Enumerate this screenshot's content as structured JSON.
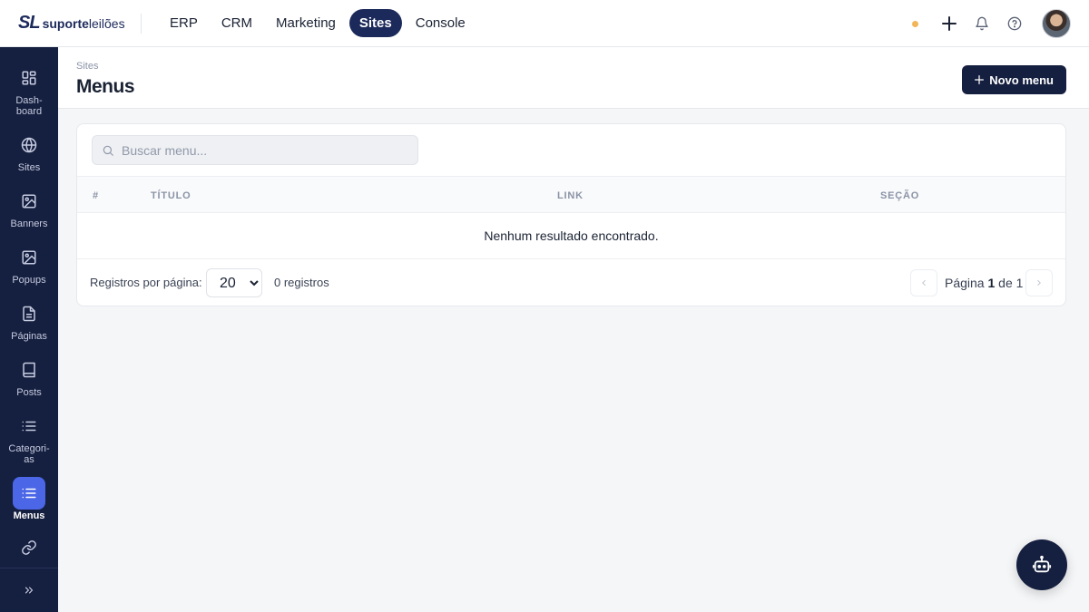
{
  "brand": {
    "mark": "SL",
    "name_bold": "suporte",
    "name_light": "leilões"
  },
  "topnav": [
    {
      "label": "ERP",
      "active": false
    },
    {
      "label": "CRM",
      "active": false
    },
    {
      "label": "Marketing",
      "active": false
    },
    {
      "label": "Sites",
      "active": true
    },
    {
      "label": "Console",
      "active": false
    }
  ],
  "topbar_icons": [
    "status-dot",
    "plus-icon",
    "bell-icon",
    "help-icon",
    "avatar"
  ],
  "sidebar": {
    "items": [
      {
        "label": "Dash-\nboard",
        "icon": "grid-icon"
      },
      {
        "label": "Sites",
        "icon": "globe-icon"
      },
      {
        "label": "Banners",
        "icon": "image-icon"
      },
      {
        "label": "Popups",
        "icon": "image-icon"
      },
      {
        "label": "Páginas",
        "icon": "file-icon"
      },
      {
        "label": "Posts",
        "icon": "book-icon"
      },
      {
        "label": "Categori-\nas",
        "icon": "list-icon"
      },
      {
        "label": "Menus",
        "icon": "list-icon",
        "active": true
      },
      {
        "label": "",
        "icon": "link-icon"
      }
    ],
    "expand_icon": "chevrons-right-icon"
  },
  "header": {
    "breadcrumb": "Sites",
    "title": "Menus",
    "new_button": "Novo menu"
  },
  "search": {
    "placeholder": "Buscar menu...",
    "value": ""
  },
  "table": {
    "columns": [
      "#",
      "TÍTULO",
      "LINK",
      "SEÇÃO"
    ],
    "empty_text": "Nenhum resultado encontrado."
  },
  "footer": {
    "per_page_label": "Registros por página:",
    "per_page_value": "20",
    "records": "0 registros",
    "page_label": "Página",
    "page_current": "1",
    "page_of": "de",
    "page_total": "1"
  },
  "colors": {
    "primary": "#151f3f",
    "accent": "#4b66e6",
    "active_nav": "#1c2a5b",
    "status_dot": "#f3b55a"
  }
}
